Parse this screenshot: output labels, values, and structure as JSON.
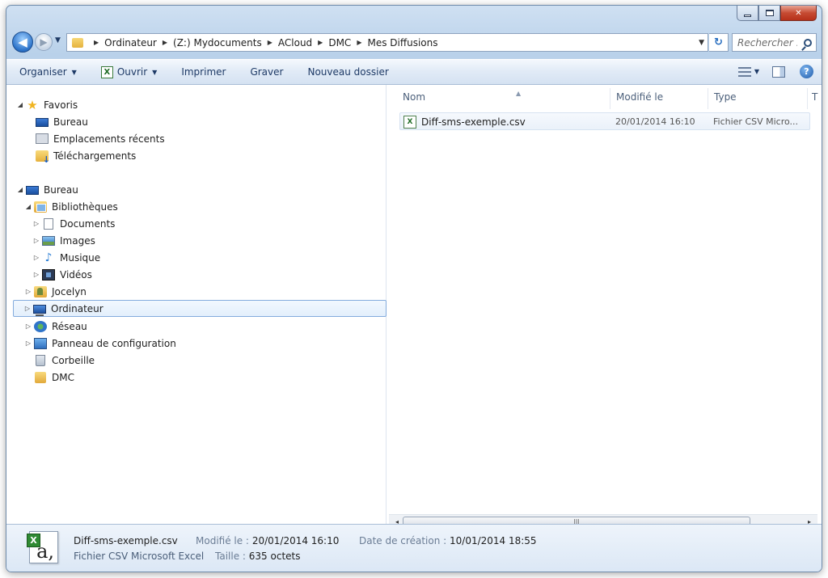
{
  "window": {
    "minimize_label": "—",
    "maximize_label": "□",
    "close_label": "✕"
  },
  "nav": {
    "back_label": "◀",
    "forward_label": "▶",
    "recent_label": "▼"
  },
  "address": {
    "crumbs": [
      "Ordinateur",
      "(Z:) Mydocuments",
      "ACloud",
      "DMC",
      "Mes Diffusions"
    ],
    "dropdown_label": "▼",
    "refresh_label": "↻"
  },
  "search": {
    "placeholder": "Rechercher ..."
  },
  "toolbar": {
    "organiser": "Organiser",
    "ouvrir": "Ouvrir",
    "imprimer": "Imprimer",
    "graver": "Graver",
    "nouveau_dossier": "Nouveau dossier",
    "help_label": "?",
    "excel_glyph": "X"
  },
  "tree": {
    "favoris": "Favoris",
    "bureau_fav": "Bureau",
    "emplacements": "Emplacements récents",
    "telechargements": "Téléchargements",
    "bureau": "Bureau",
    "bibliotheques": "Bibliothèques",
    "documents": "Documents",
    "images": "Images",
    "musique": "Musique",
    "videos": "Vidéos",
    "jocelyn": "Jocelyn",
    "ordinateur": "Ordinateur",
    "reseau": "Réseau",
    "panneau": "Panneau de configuration",
    "corbeille": "Corbeille",
    "dmc": "DMC"
  },
  "columns": {
    "nom": "Nom",
    "modifie": "Modifié le",
    "type": "Type",
    "taille_stub": "T"
  },
  "files": [
    {
      "name": "Diff-sms-exemple.csv",
      "modified": "20/01/2014 16:10",
      "type": "Fichier CSV Micro..."
    }
  ],
  "scrollbar": {
    "thumb_grip": "III",
    "left_label": "◂",
    "right_label": "▸"
  },
  "details": {
    "name": "Diff-sms-exemple.csv",
    "type": "Fichier CSV Microsoft Excel",
    "modified_label": "Modifié le :",
    "modified_value": "20/01/2014 16:10",
    "size_label": "Taille :",
    "size_value": "635 octets",
    "created_label": "Date de création :",
    "created_value": "10/01/2014 18:55",
    "icon_badge": "X",
    "icon_letter": "a,"
  }
}
